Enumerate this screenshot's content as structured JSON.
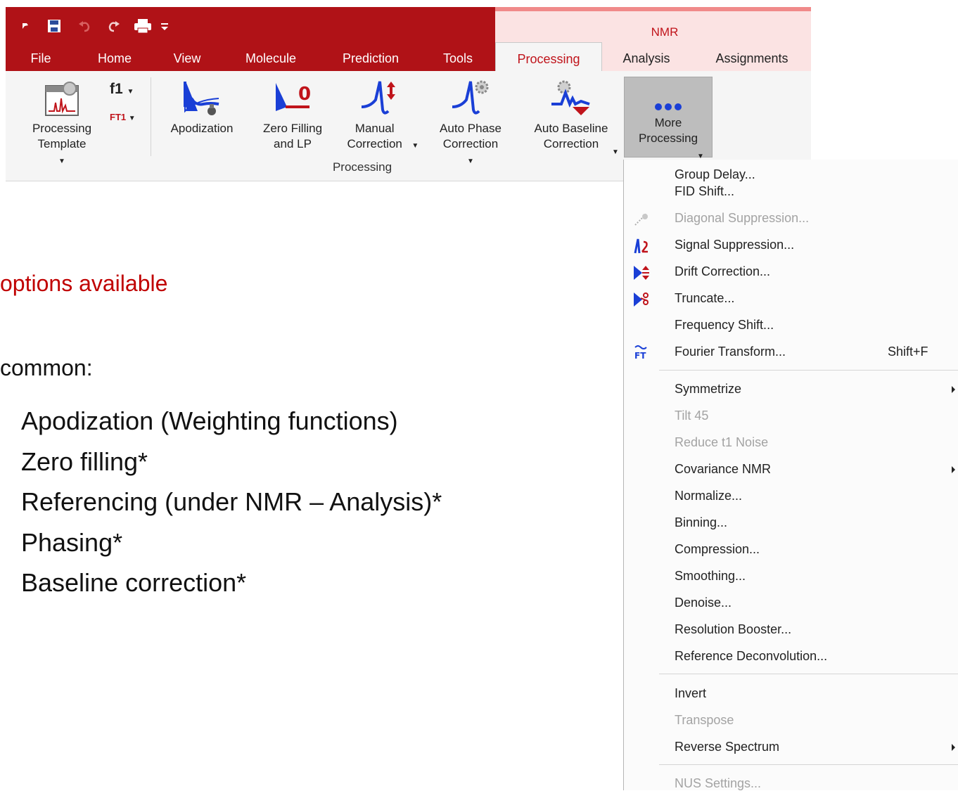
{
  "titlebar": {
    "context_label": "NMR",
    "tabs": [
      "File",
      "Home",
      "View",
      "Molecule",
      "Prediction",
      "Tools",
      "Processing",
      "Analysis",
      "Assignments"
    ]
  },
  "ribbon": {
    "processing_template": "Processing Template",
    "f1": "f1",
    "ft1": "FT1",
    "apodization": "Apodization",
    "zero_filling": "Zero Filling and LP",
    "manual_correction": "Manual Correction",
    "auto_phase": "Auto Phase Correction",
    "auto_baseline": "Auto Baseline Correction",
    "more_processing": "More Processing",
    "group_label": "Processing"
  },
  "slide": {
    "options": "options available",
    "common": "common:",
    "bullets": [
      "Apodization (Weighting functions)",
      "Zero filling*",
      "Referencing (under NMR – Analysis)*",
      "Phasing*",
      "Baseline correction*"
    ]
  },
  "menu": {
    "items": [
      "Group Delay...",
      "FID Shift...",
      "Diagonal Suppression...",
      "Signal Suppression...",
      "Drift Correction...",
      "Truncate...",
      "Frequency Shift...",
      "Fourier Transform...",
      "Symmetrize",
      "Tilt 45",
      "Reduce t1 Noise",
      "Covariance NMR",
      "Normalize...",
      "Binning...",
      "Compression...",
      "Smoothing...",
      "Denoise...",
      "Resolution Booster...",
      "Reference Deconvolution...",
      "Invert",
      "Transpose",
      "Reverse Spectrum",
      "NUS Settings..."
    ],
    "fourier_shortcut": "Shift+F"
  },
  "colors": {
    "ribbon_red": "#b01217",
    "accent_red": "#c00000",
    "blue": "#1a3fd6"
  }
}
